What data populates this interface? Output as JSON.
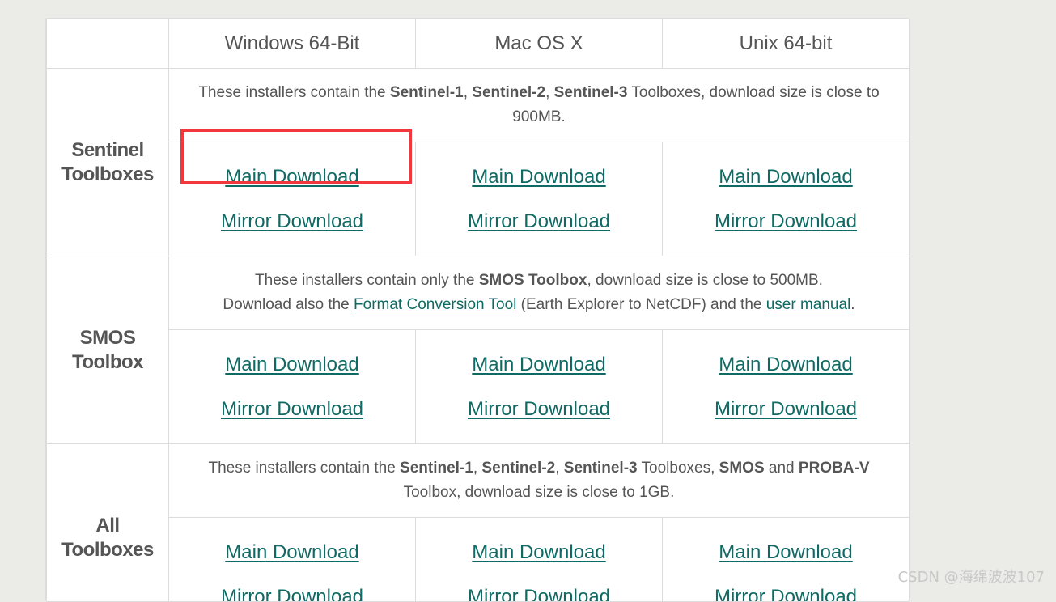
{
  "header": {
    "windows": "Windows 64-Bit",
    "mac": "Mac OS X",
    "unix": "Unix 64-bit"
  },
  "sections": [
    {
      "cat_line1": "Sentinel",
      "cat_line2": "Toolboxes",
      "desc": {
        "p1": "These installers contain the ",
        "b1": "Sentinel-1",
        "s1": ", ",
        "b2": "Sentinel-2",
        "s2": ", ",
        "b3": "Sentinel-3",
        "p2": " Toolboxes, download size is close to 900MB."
      }
    },
    {
      "cat_line1": "SMOS",
      "cat_line2": "Toolbox",
      "desc": {
        "p1": "These installers contain only the ",
        "b1": "SMOS Toolbox",
        "p2": ", download size is close to 500MB.",
        "p3": "Download also the ",
        "link1": "Format Conversion Tool",
        "p4": " (Earth Explorer to NetCDF) and the ",
        "link2": "user manual",
        "p5": "."
      }
    },
    {
      "cat_line1": "All",
      "cat_line2": "Toolboxes",
      "desc": {
        "p1": "These installers contain the ",
        "b1": "Sentinel-1",
        "s1": ", ",
        "b2": "Sentinel-2",
        "s2": ", ",
        "b3": "Sentinel-3",
        "p2": " Toolboxes, ",
        "b4": "SMOS",
        "p3": " and ",
        "b5": "PROBA-V",
        "p4": " Toolbox, download size is close to 1GB."
      }
    }
  ],
  "links": {
    "main": "Main Download",
    "mirror": "Mirror Download"
  },
  "watermark": "CSDN @海绵波波107",
  "colors": {
    "link": "#0f6a64",
    "highlight": "#f2383c"
  }
}
